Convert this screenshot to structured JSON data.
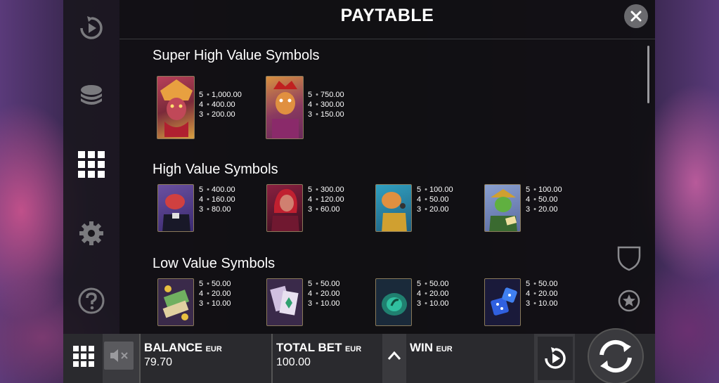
{
  "header": {
    "title": "PAYTABLE"
  },
  "sections": [
    {
      "title": "Super High Value Symbols",
      "symbols": [
        {
          "icon": "triceratops-chief-icon",
          "pays": [
            [
              "5",
              "1,000.00"
            ],
            [
              "4",
              "400.00"
            ],
            [
              "3",
              "200.00"
            ]
          ]
        },
        {
          "icon": "dragon-king-icon",
          "pays": [
            [
              "5",
              "750.00"
            ],
            [
              "4",
              "300.00"
            ],
            [
              "3",
              "150.00"
            ]
          ]
        }
      ]
    },
    {
      "title": "High Value Symbols",
      "symbols": [
        {
          "icon": "croc-boss-icon",
          "pays": [
            [
              "5",
              "400.00"
            ],
            [
              "4",
              "160.00"
            ],
            [
              "3",
              "80.00"
            ]
          ]
        },
        {
          "icon": "lady-dino-icon",
          "pays": [
            [
              "5",
              "300.00"
            ],
            [
              "4",
              "120.00"
            ],
            [
              "3",
              "60.00"
            ]
          ]
        },
        {
          "icon": "dino-singer-icon",
          "pays": [
            [
              "5",
              "100.00"
            ],
            [
              "4",
              "50.00"
            ],
            [
              "3",
              "20.00"
            ]
          ]
        },
        {
          "icon": "lizard-gambler-icon",
          "pays": [
            [
              "5",
              "100.00"
            ],
            [
              "4",
              "50.00"
            ],
            [
              "3",
              "20.00"
            ]
          ]
        }
      ]
    },
    {
      "title": "Low Value Symbols",
      "symbols": [
        {
          "icon": "money-stack-icon",
          "pays": [
            [
              "5",
              "50.00"
            ],
            [
              "4",
              "20.00"
            ],
            [
              "3",
              "10.00"
            ]
          ]
        },
        {
          "icon": "playing-cards-icon",
          "pays": [
            [
              "5",
              "50.00"
            ],
            [
              "4",
              "20.00"
            ],
            [
              "3",
              "10.00"
            ]
          ]
        },
        {
          "icon": "casino-chip-icon",
          "pays": [
            [
              "5",
              "50.00"
            ],
            [
              "4",
              "20.00"
            ],
            [
              "3",
              "10.00"
            ]
          ]
        },
        {
          "icon": "dice-icon",
          "pays": [
            [
              "5",
              "50.00"
            ],
            [
              "4",
              "20.00"
            ],
            [
              "3",
              "10.00"
            ]
          ]
        }
      ]
    }
  ],
  "bottom_bar": {
    "balance_label": "BALANCE",
    "balance_currency": "EUR",
    "balance_value": "79.70",
    "total_bet_label": "TOTAL BET",
    "total_bet_currency": "EUR",
    "total_bet_value": "100.00",
    "win_label": "WIN",
    "win_currency": "EUR"
  },
  "colors": {
    "panel_bg": "#0e0e10",
    "bottom_bar_bg": "#2a2a2e",
    "accent_gold": "#c8a040"
  }
}
